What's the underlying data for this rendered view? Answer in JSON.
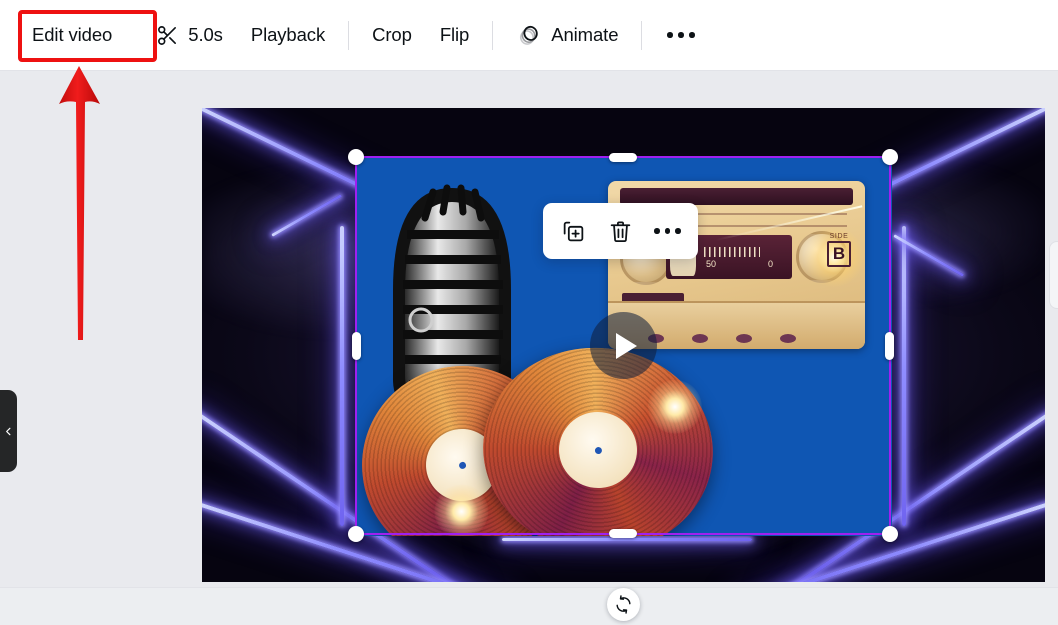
{
  "app": {
    "name": "video-editor",
    "accent_purple": "#a020f0",
    "accent_blue": "#0f56b3",
    "annotation_red": "#ee1111",
    "toolbar_bg": "#ffffff",
    "stage_bg": "#e9eaee"
  },
  "toolbar": {
    "edit_video_label": "Edit video",
    "duration_label": "5.0s",
    "duration_icon": "scissors-icon",
    "playback_label": "Playback",
    "crop_label": "Crop",
    "flip_label": "Flip",
    "animate_label": "Animate",
    "animate_icon": "overlapping-circles-icon",
    "more_icon": "three-dots-icon"
  },
  "context_toolbar": {
    "duplicate_icon": "duplicate-icon",
    "delete_icon": "trash-icon",
    "more_icon": "three-dots-icon"
  },
  "canvas": {
    "play_icon": "play-icon",
    "rotate_icon": "rotate-icon",
    "collapse_icon": "chevron-left-icon",
    "selection": {
      "handles": [
        "top-left",
        "top-center",
        "top-right",
        "middle-left",
        "middle-right",
        "bottom-left",
        "bottom-center",
        "bottom-right"
      ]
    },
    "artwork": {
      "background": "neon-tunnel-perspective",
      "elements": [
        "vintage-microphone",
        "cassette-tape",
        "vinyl-records"
      ],
      "cassette_side_caption": "SIDE",
      "cassette_side_value": "B",
      "cassette_counter_left": "50",
      "cassette_counter_right": "0"
    }
  }
}
